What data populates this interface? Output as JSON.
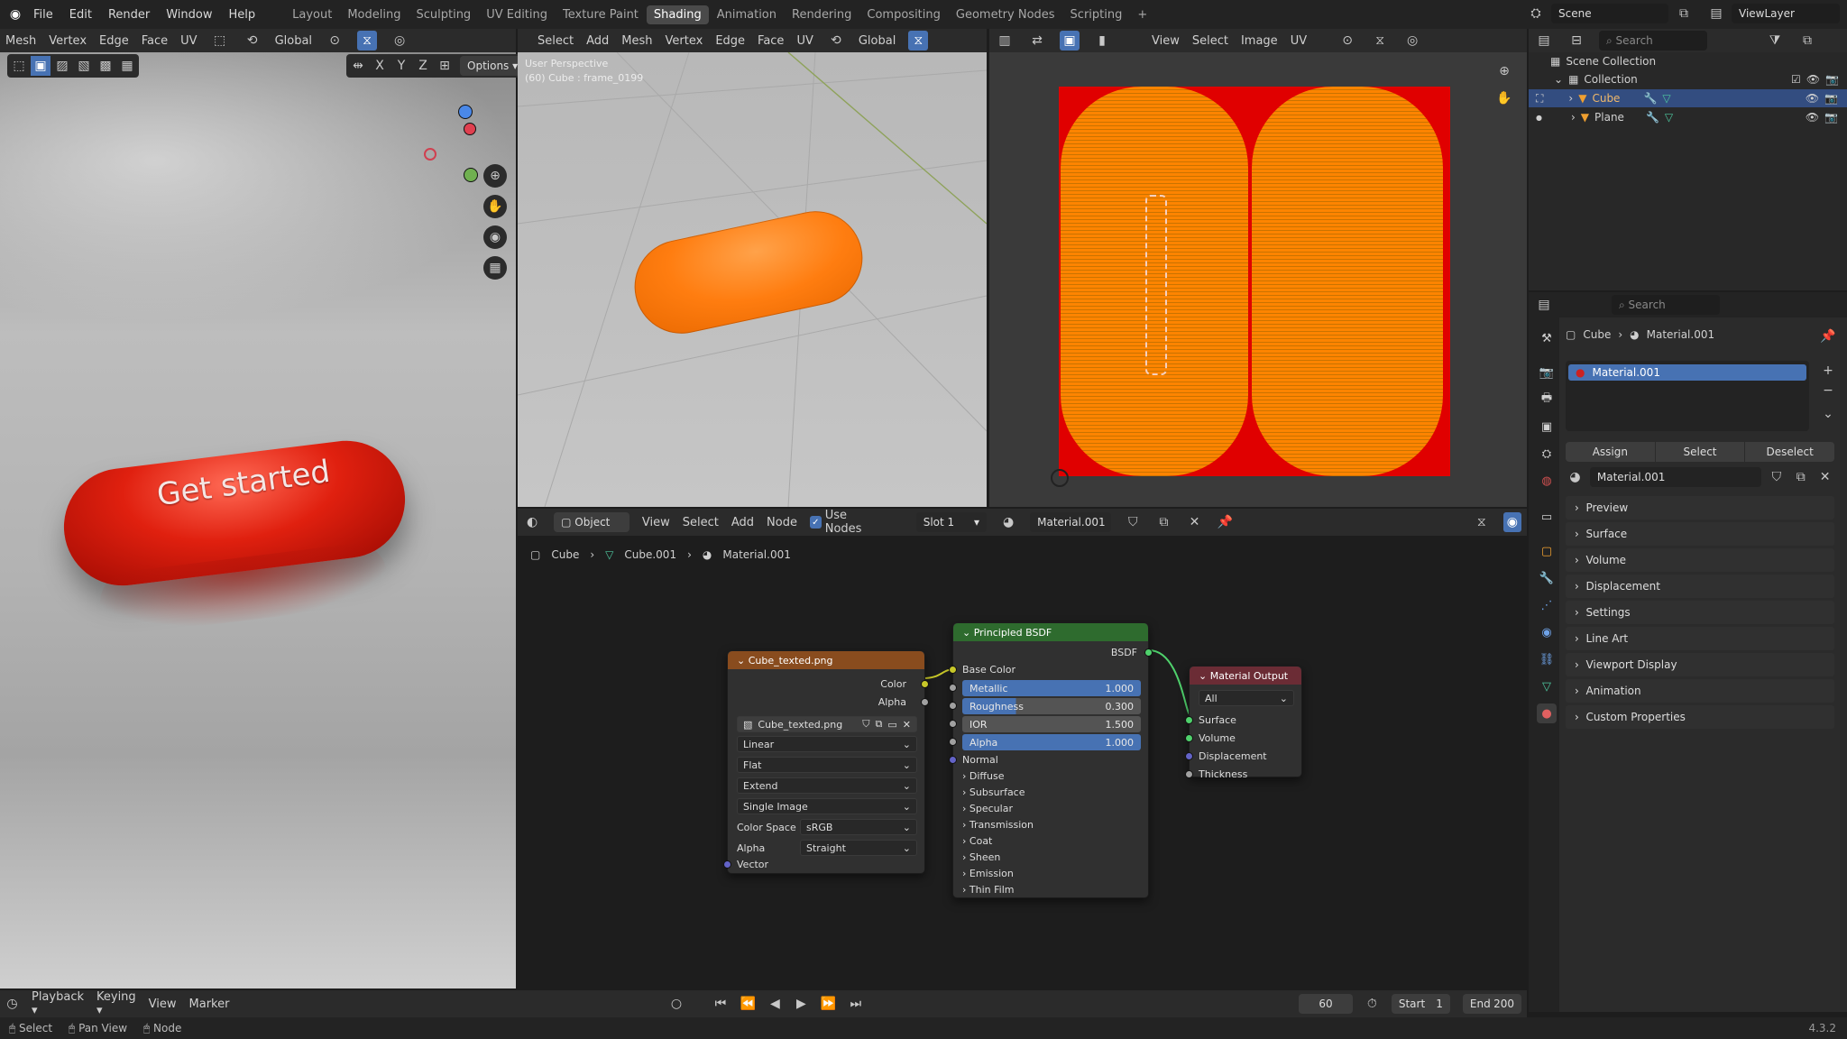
{
  "menu": {
    "file": "File",
    "edit": "Edit",
    "render": "Render",
    "window": "Window",
    "help": "Help"
  },
  "workspaces": [
    "Layout",
    "Modeling",
    "Sculpting",
    "UV Editing",
    "Texture Paint",
    "Shading",
    "Animation",
    "Rendering",
    "Compositing",
    "Geometry Nodes",
    "Scripting"
  ],
  "active_workspace": "Shading",
  "scene": {
    "label": "Scene",
    "view_layer": "ViewLayer"
  },
  "left_viewport": {
    "menus": [
      "Mesh",
      "Vertex",
      "Edge",
      "Face",
      "UV"
    ],
    "transform": "Global",
    "options": "Options",
    "render_text": "Get started",
    "axes": {
      "x": "X",
      "y": "Y",
      "z": "Z"
    }
  },
  "mid_viewport": {
    "menus": [
      "Select",
      "Add",
      "Mesh",
      "Vertex",
      "Edge",
      "Face",
      "UV"
    ],
    "transform": "Global",
    "info1": "User Perspective",
    "info2": "(60) Cube : frame_0199"
  },
  "uv_editor": {
    "menus": [
      "View",
      "Select",
      "Image",
      "UV"
    ]
  },
  "outliner": {
    "search": "Search",
    "scene_collection": "Scene Collection",
    "collection": "Collection",
    "items": [
      "Cube",
      "Plane"
    ]
  },
  "properties": {
    "search": "Search",
    "breadcrumb_obj": "Cube",
    "breadcrumb_mat": "Material.001",
    "slot": "Material.001",
    "assign": "Assign",
    "select": "Select",
    "deselect": "Deselect",
    "material_name": "Material.001",
    "sections": [
      "Preview",
      "Surface",
      "Volume",
      "Displacement",
      "Settings",
      "Line Art",
      "Viewport Display",
      "Animation",
      "Custom Properties"
    ]
  },
  "node_editor": {
    "mode": "Object",
    "menus": [
      "View",
      "Select",
      "Add",
      "Node"
    ],
    "use_nodes": "Use Nodes",
    "slot": "Slot 1",
    "material": "Material.001",
    "breadcrumb": [
      "Cube",
      "Cube.001",
      "Material.001"
    ],
    "image_node": {
      "title": "Cube_texted.png",
      "out_color": "Color",
      "out_alpha": "Alpha",
      "image": "Cube_texted.png",
      "interp": "Linear",
      "proj": "Flat",
      "ext": "Extend",
      "source": "Single Image",
      "colorspace_label": "Color Space",
      "colorspace": "sRGB",
      "alpha_label": "Alpha",
      "alpha": "Straight",
      "vector": "Vector"
    },
    "bsdf_node": {
      "title": "Principled BSDF",
      "out": "BSDF",
      "base_color": "Base Color",
      "metallic_label": "Metallic",
      "metallic": "1.000",
      "roughness_label": "Roughness",
      "roughness": "0.300",
      "ior_label": "IOR",
      "ior": "1.500",
      "alpha_label": "Alpha",
      "alpha": "1.000",
      "normal": "Normal",
      "panels": [
        "Diffuse",
        "Subsurface",
        "Specular",
        "Transmission",
        "Coat",
        "Sheen",
        "Emission",
        "Thin Film"
      ]
    },
    "output_node": {
      "title": "Material Output",
      "target": "All",
      "inputs": [
        "Surface",
        "Volume",
        "Displacement",
        "Thickness"
      ]
    }
  },
  "timeline": {
    "menus": [
      "Playback",
      "Keying",
      "View",
      "Marker"
    ],
    "frame": "60",
    "start_label": "Start",
    "start": "1",
    "end_label": "End",
    "end": "200"
  },
  "statusbar": {
    "select": "Select",
    "pan": "Pan View",
    "node": "Node",
    "version": "4.3.2"
  }
}
